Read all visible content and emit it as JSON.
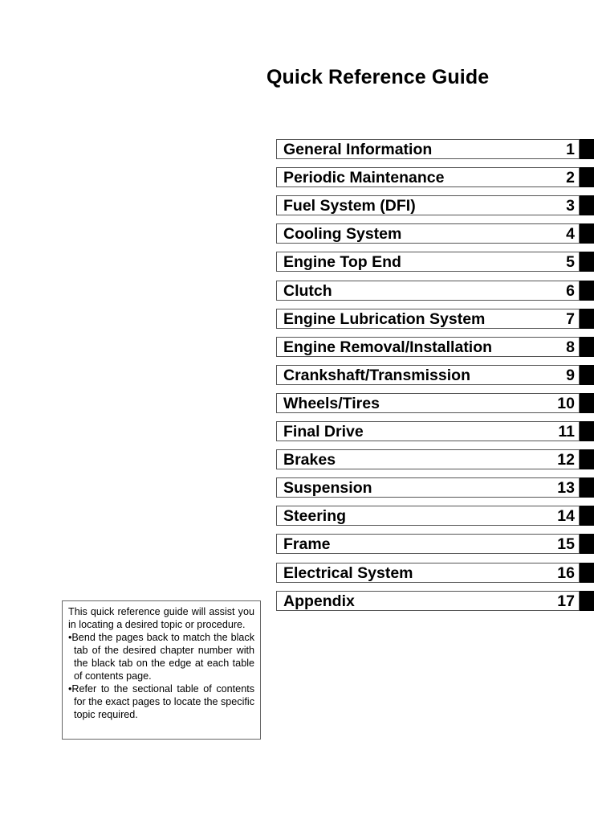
{
  "page": {
    "title": "Quick Reference Guide"
  },
  "toc": {
    "items": [
      {
        "label": "General Information",
        "number": "1"
      },
      {
        "label": "Periodic Maintenance",
        "number": "2"
      },
      {
        "label": "Fuel System (DFI)",
        "number": "3"
      },
      {
        "label": "Cooling System",
        "number": "4"
      },
      {
        "label": "Engine Top End",
        "number": "5"
      },
      {
        "label": "Clutch",
        "number": "6"
      },
      {
        "label": "Engine Lubrication System",
        "number": "7"
      },
      {
        "label": "Engine Removal/Installation",
        "number": "8"
      },
      {
        "label": "Crankshaft/Transmission",
        "number": "9"
      },
      {
        "label": "Wheels/Tires",
        "number": "10"
      },
      {
        "label": "Final Drive",
        "number": "11"
      },
      {
        "label": "Brakes",
        "number": "12"
      },
      {
        "label": "Suspension",
        "number": "13"
      },
      {
        "label": "Steering",
        "number": "14"
      },
      {
        "label": "Frame",
        "number": "15"
      },
      {
        "label": "Electrical System",
        "number": "16"
      },
      {
        "label": "Appendix",
        "number": "17"
      }
    ]
  },
  "info": {
    "intro": "This quick reference guide will assist you in locating a desired topic or procedure.",
    "bullets": [
      "•Bend the pages back to match the black tab of the desired chapter number with the black tab on the edge at each table of contents page.",
      "•Refer to the sectional table of contents for the exact pages to locate the specific topic required."
    ]
  }
}
